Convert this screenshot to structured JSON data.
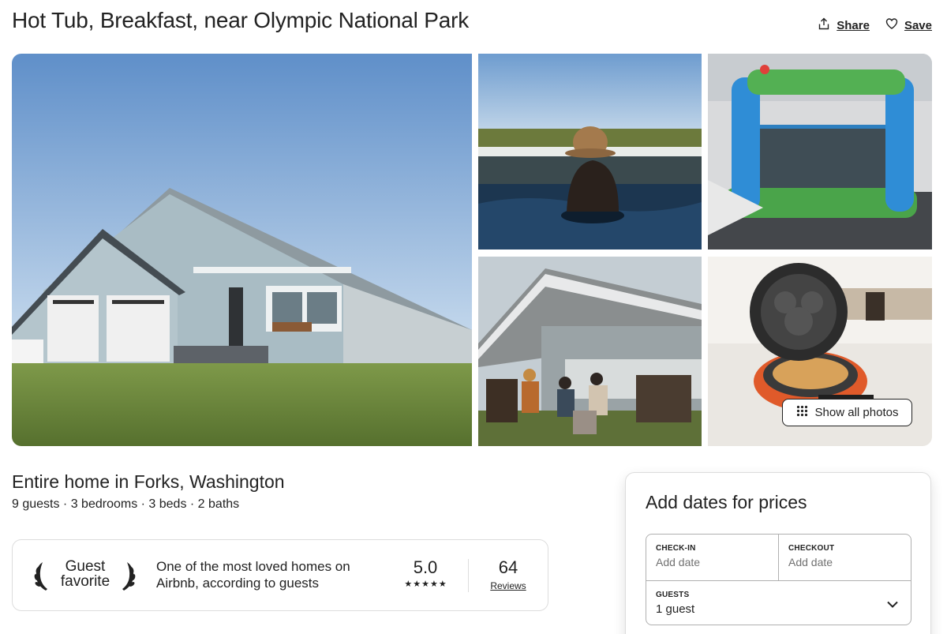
{
  "listing": {
    "title": "Hot Tub, Breakfast, near Olympic National Park",
    "share_label": "Share",
    "save_label": "Save",
    "show_all_photos_label": "Show all photos",
    "subtitle": "Entire home in Forks, Washington",
    "facts": "9 guests · 3 bedrooms · 3 beds · 2 baths"
  },
  "guest_favorite": {
    "badge_line1": "Guest",
    "badge_line2": "favorite",
    "description": "One of the most loved homes on Airbnb, according to guests",
    "rating": "5.0",
    "stars": 5,
    "review_count": "64",
    "reviews_label": "Reviews"
  },
  "booking": {
    "title": "Add dates for prices",
    "checkin_label": "CHECK-IN",
    "checkin_value": "Add date",
    "checkout_label": "CHECKOUT",
    "checkout_value": "Add date",
    "guests_label": "GUESTS",
    "guests_value": "1 guest"
  },
  "icons": {
    "share": "share-icon",
    "save": "heart-icon",
    "show_all": "grid-dots-icon",
    "laurel_left": "laurel-left-icon",
    "laurel_right": "laurel-right-icon",
    "guests_dropdown": "chevron-down-icon"
  },
  "colors": {
    "text": "#222222",
    "muted": "#717171",
    "border": "#dddddd"
  }
}
